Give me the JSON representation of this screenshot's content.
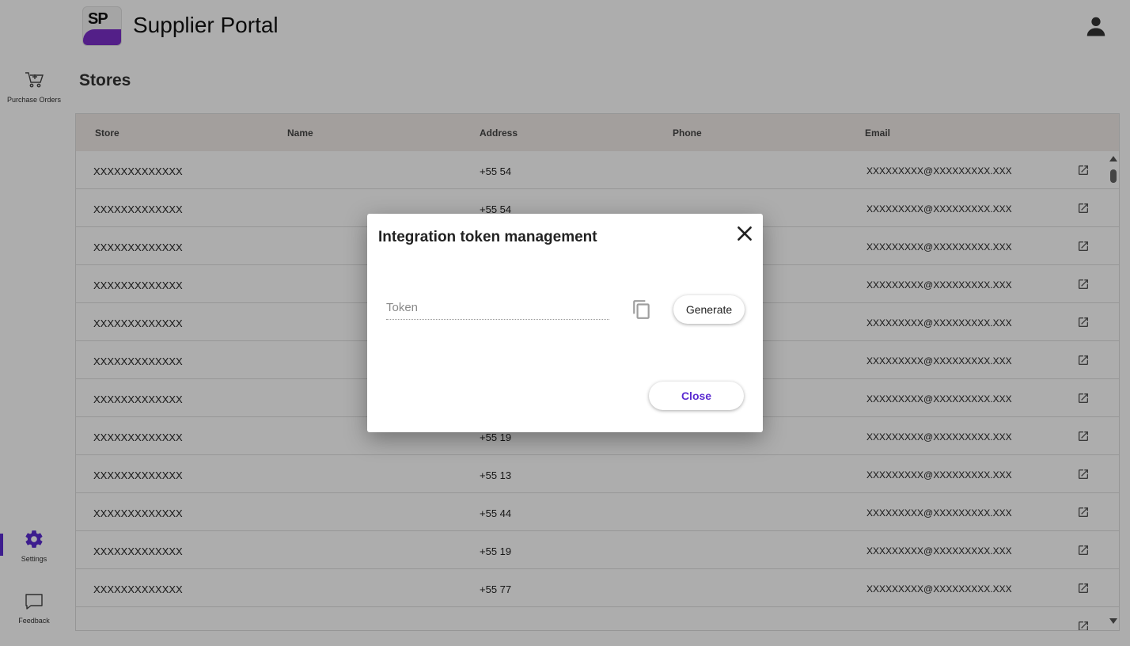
{
  "header": {
    "logo_text": "SP",
    "title": "Supplier Portal",
    "account_icon": "account-circle-icon"
  },
  "sidebar": {
    "items": [
      {
        "label": "Purchase Orders",
        "icon": "cart-icon"
      },
      {
        "label": "Settings",
        "icon": "gear-icon",
        "active": true
      },
      {
        "label": "Feedback",
        "icon": "chat-bubble-icon"
      }
    ]
  },
  "page": {
    "title": "Stores"
  },
  "table": {
    "columns": [
      "Store",
      "Name",
      "Address",
      "Phone",
      "Email"
    ],
    "rows": [
      {
        "store": "XXXXXXXXXXXXX",
        "phone": "+55 54",
        "email": "XXXXXXXXX@XXXXXXXXX.XXX"
      },
      {
        "store": "XXXXXXXXXXXXX",
        "phone": "+55 54",
        "email": "XXXXXXXXX@XXXXXXXXX.XXX"
      },
      {
        "store": "XXXXXXXXXXXXX",
        "phone": "",
        "email": "XXXXXXXXX@XXXXXXXXX.XXX"
      },
      {
        "store": "XXXXXXXXXXXXX",
        "phone": "",
        "email": "XXXXXXXXX@XXXXXXXXX.XXX"
      },
      {
        "store": "XXXXXXXXXXXXX",
        "phone": "",
        "email": "XXXXXXXXX@XXXXXXXXX.XXX"
      },
      {
        "store": "XXXXXXXXXXXXX",
        "phone": "",
        "email": "XXXXXXXXX@XXXXXXXXX.XXX"
      },
      {
        "store": "XXXXXXXXXXXXX",
        "phone": "",
        "email": "XXXXXXXXX@XXXXXXXXX.XXX"
      },
      {
        "store": "XXXXXXXXXXXXX",
        "phone": "+55 19",
        "email": "XXXXXXXXX@XXXXXXXXX.XXX"
      },
      {
        "store": "XXXXXXXXXXXXX",
        "phone": "+55 13",
        "email": "XXXXXXXXX@XXXXXXXXX.XXX"
      },
      {
        "store": "XXXXXXXXXXXXX",
        "phone": "+55 44",
        "email": "XXXXXXXXX@XXXXXXXXX.XXX"
      },
      {
        "store": "XXXXXXXXXXXXX",
        "phone": "+55 19",
        "email": "XXXXXXXXX@XXXXXXXXX.XXX"
      },
      {
        "store": "XXXXXXXXXXXXX",
        "phone": "+55 77",
        "email": "XXXXXXXXX@XXXXXXXXX.XXX"
      },
      {
        "store": "",
        "phone": "",
        "email": ""
      }
    ]
  },
  "dialog": {
    "title": "Integration token management",
    "token_value": "",
    "token_placeholder": "Token",
    "generate_label": "Generate",
    "close_label": "Close"
  },
  "colors": {
    "accent": "#5b2bd1",
    "header_row": "#f1ebe8",
    "logo_purple": "#7b2fc9"
  }
}
